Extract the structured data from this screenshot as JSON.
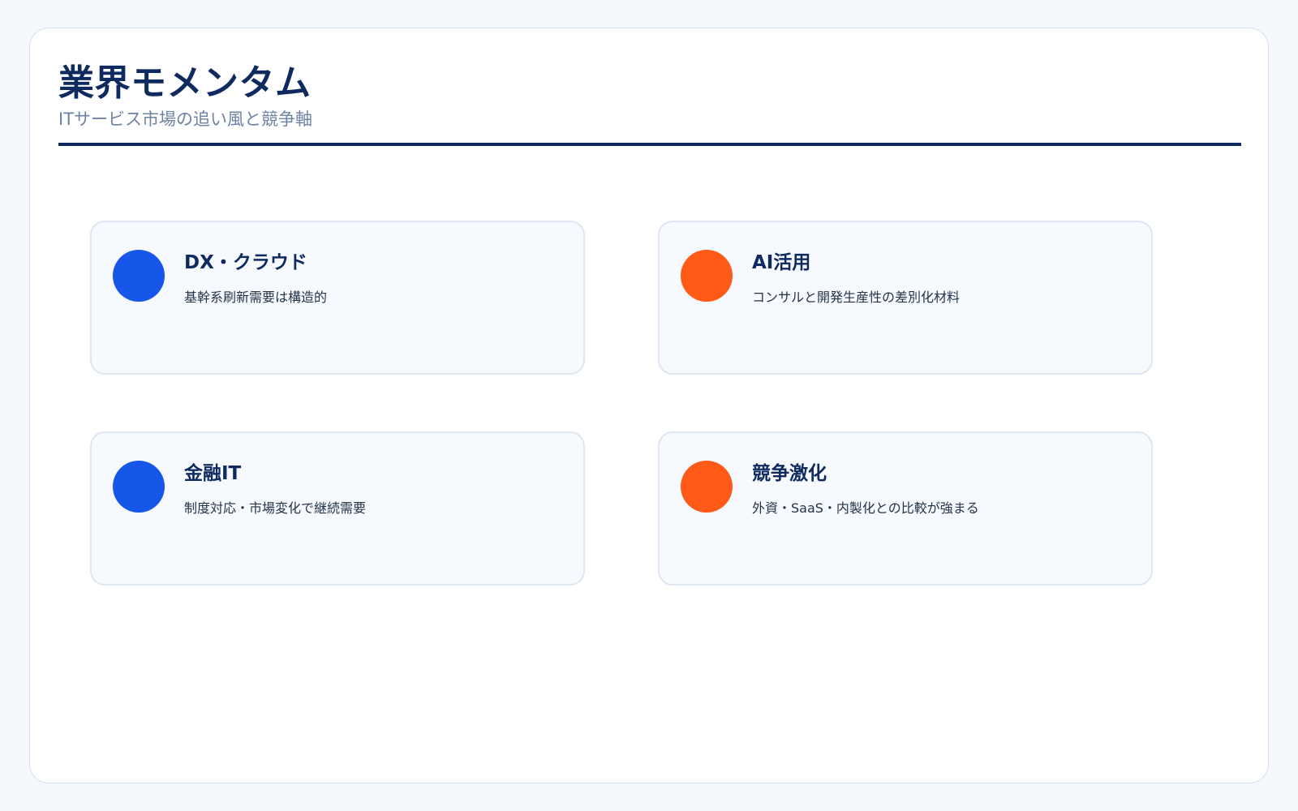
{
  "slide": {
    "title": "業界モメンタム",
    "subtitle": "ITサービス市場の追い風と競争軸"
  },
  "colors": {
    "navy": "#0f2a5e",
    "blue": "#1656e8",
    "orange": "#ff5a17",
    "card_bg": "#f6f9fd",
    "card_border": "#dde6f1"
  },
  "cards": [
    {
      "title": "DX・クラウド",
      "description": "基幹系刷新需要は構造的",
      "marker": "blue-circle"
    },
    {
      "title": "AI活用",
      "description": "コンサルと開発生産性の差別化材料",
      "marker": "orange-circle"
    },
    {
      "title": "金融IT",
      "description": "制度対応・市場変化で継続需要",
      "marker": "blue-circle"
    },
    {
      "title": "競争激化",
      "description": "外資・SaaS・内製化との比較が強まる",
      "marker": "orange-circle"
    }
  ]
}
